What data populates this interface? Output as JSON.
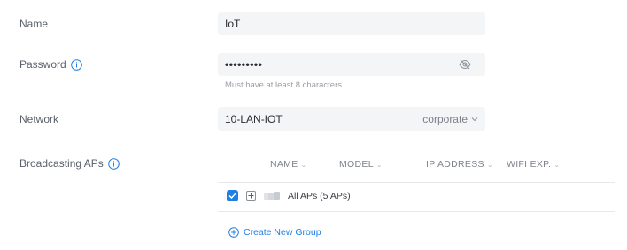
{
  "form": {
    "name": {
      "label": "Name",
      "value": "IoT"
    },
    "password": {
      "label": "Password",
      "value": "•••••••••",
      "hint": "Must have at least 8 characters.",
      "toggle_icon": "eye-slash-icon"
    },
    "network": {
      "label": "Network",
      "value": "10-LAN-IOT",
      "tag": "corporate"
    },
    "broadcasting": {
      "label": "Broadcasting APs"
    }
  },
  "table": {
    "columns": [
      "NAME",
      "MODEL",
      "IP ADDRESS",
      "WIFI EXP."
    ],
    "row": {
      "label": "All APs (5 APs)",
      "checked": true
    }
  },
  "create_group": {
    "label": "Create New Group"
  },
  "colors": {
    "accent": "#1f7fe5",
    "field_bg": "#f4f5f6",
    "label": "#5a5f6a"
  }
}
